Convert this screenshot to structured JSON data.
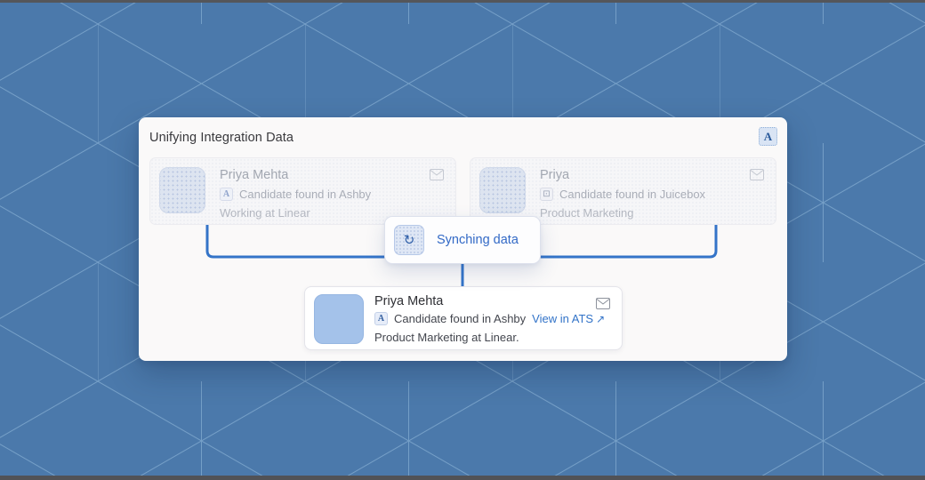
{
  "page": {
    "title": "Unifying Integration Data"
  },
  "header": {
    "ashby_logo_letter": "A"
  },
  "source_cards": [
    {
      "name": "Priya Mehta",
      "badge_glyph": "A",
      "found": "Candidate found in Ashby",
      "detail": "Working at Linear"
    },
    {
      "name": "Priya",
      "badge_glyph": "⊡",
      "found": "Candidate found in Juicebox",
      "detail": "Product Marketing"
    }
  ],
  "sync_pill": {
    "label": "Synching data",
    "glyph": "↻"
  },
  "result_card": {
    "name": "Priya Mehta",
    "badge_glyph": "A",
    "found": "Candidate found in Ashby",
    "link_label": "View in ATS",
    "link_arrow": "↗",
    "detail": "Product Marketing at Linear."
  },
  "colors": {
    "background": "#4b79ab",
    "pattern_line": "#9fc6e4",
    "connector": "#3474c8",
    "accent_blue": "#3269c6",
    "card_bg": "#faf9f9"
  }
}
